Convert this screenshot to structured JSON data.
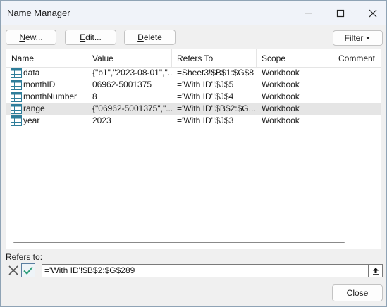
{
  "window": {
    "title": "Name Manager"
  },
  "toolbar": {
    "new_label": {
      "pre": "",
      "u": "N",
      "post": "ew..."
    },
    "edit_label": {
      "pre": "",
      "u": "E",
      "post": "dit..."
    },
    "delete_label": {
      "pre": "",
      "u": "D",
      "post": "elete"
    },
    "filter_label": {
      "pre": "",
      "u": "F",
      "post": "ilter"
    }
  },
  "list": {
    "columns": [
      "Name",
      "Value",
      "Refers To",
      "Scope",
      "Comment"
    ],
    "rows": [
      {
        "name": "data",
        "value": "{\"b1\",\"2023-08-01\",\"...",
        "refers_to": "=Sheet3!$B$1:$G$8",
        "scope": "Workbook",
        "comment": ""
      },
      {
        "name": "monthID",
        "value": "06962-5001375",
        "refers_to": "='With ID'!$J$5",
        "scope": "Workbook",
        "comment": ""
      },
      {
        "name": "monthNumber",
        "value": "8",
        "refers_to": "='With ID'!$J$4",
        "scope": "Workbook",
        "comment": ""
      },
      {
        "name": "range",
        "value": "{\"06962-5001375\",\"...",
        "refers_to": "='With ID'!$B$2:$G...",
        "scope": "Workbook",
        "comment": ""
      },
      {
        "name": "year",
        "value": "2023",
        "refers_to": "='With ID'!$J$3",
        "scope": "Workbook",
        "comment": ""
      }
    ],
    "selected_index": 3
  },
  "refers": {
    "label": {
      "pre": "",
      "u": "R",
      "post": "efers to:"
    },
    "value": "='With ID'!$B$2:$G$289"
  },
  "footer": {
    "close_label": "Close"
  },
  "colors": {
    "accent": "#2e7d9a",
    "selection": "#e5e5e5",
    "check": "#2e9e7a"
  },
  "icons": [
    "minimize-icon",
    "maximize-icon",
    "close-icon",
    "filter-dropdown-icon",
    "name-table-icon",
    "cancel-x-icon",
    "confirm-check-icon",
    "collapse-dialog-icon"
  ]
}
